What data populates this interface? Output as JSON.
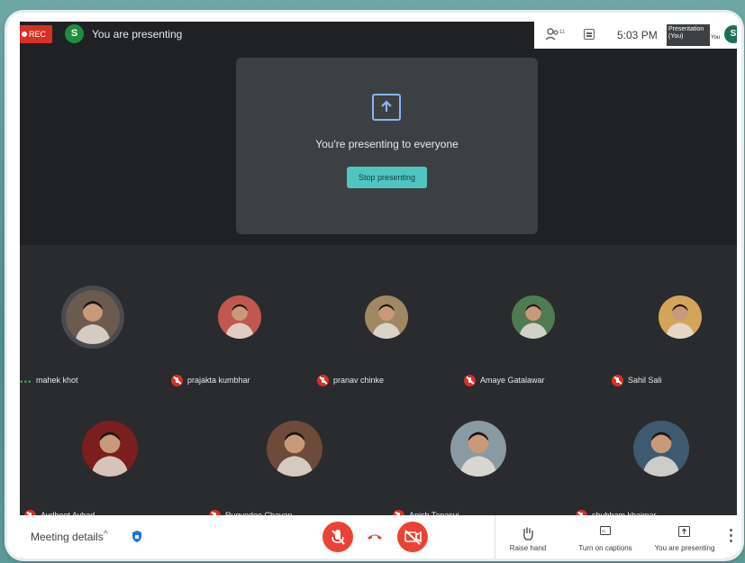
{
  "topbar": {
    "rec_label": "REC",
    "presenter_initial": "S",
    "presenting_text": "You are presenting",
    "participant_count": "11",
    "time": "5:03 PM",
    "mini_tile_label": "Presentation (You)",
    "mini_you": "You",
    "user_initial": "S"
  },
  "presentation": {
    "message": "You're presenting to everyone",
    "stop_label": "Stop presenting"
  },
  "participants": [
    {
      "name": "mahek khot",
      "muted": false,
      "speaking": true,
      "color": "#6b5a4e"
    },
    {
      "name": "prajakta kumbhar",
      "muted": true,
      "color": "#c0584f"
    },
    {
      "name": "pranav chinke",
      "muted": true,
      "color": "#a08864"
    },
    {
      "name": "Amaye Gatalawar",
      "muted": true,
      "color": "#4f7b52"
    },
    {
      "name": "Sahil Sali",
      "muted": true,
      "color": "#d4a45a"
    },
    {
      "name": "Avdhoot Avhad",
      "muted": true,
      "color": "#7a1e1e"
    },
    {
      "name": "Rugvedee Chavan",
      "muted": true,
      "color": "#6d4a3a"
    },
    {
      "name": "Anish Tapasvi",
      "muted": true,
      "color": "#8a9aa4"
    },
    {
      "name": "shubham khaimar",
      "muted": true,
      "color": "#3e5a70"
    }
  ],
  "bottombar": {
    "meeting_details": "Meeting details",
    "raise_hand": "Raise hand",
    "captions": "Turn on captions",
    "presenting": "You are presenting"
  },
  "colors": {
    "accent": "#50c5c0",
    "danger": "#ea4335",
    "background": "#202124"
  }
}
